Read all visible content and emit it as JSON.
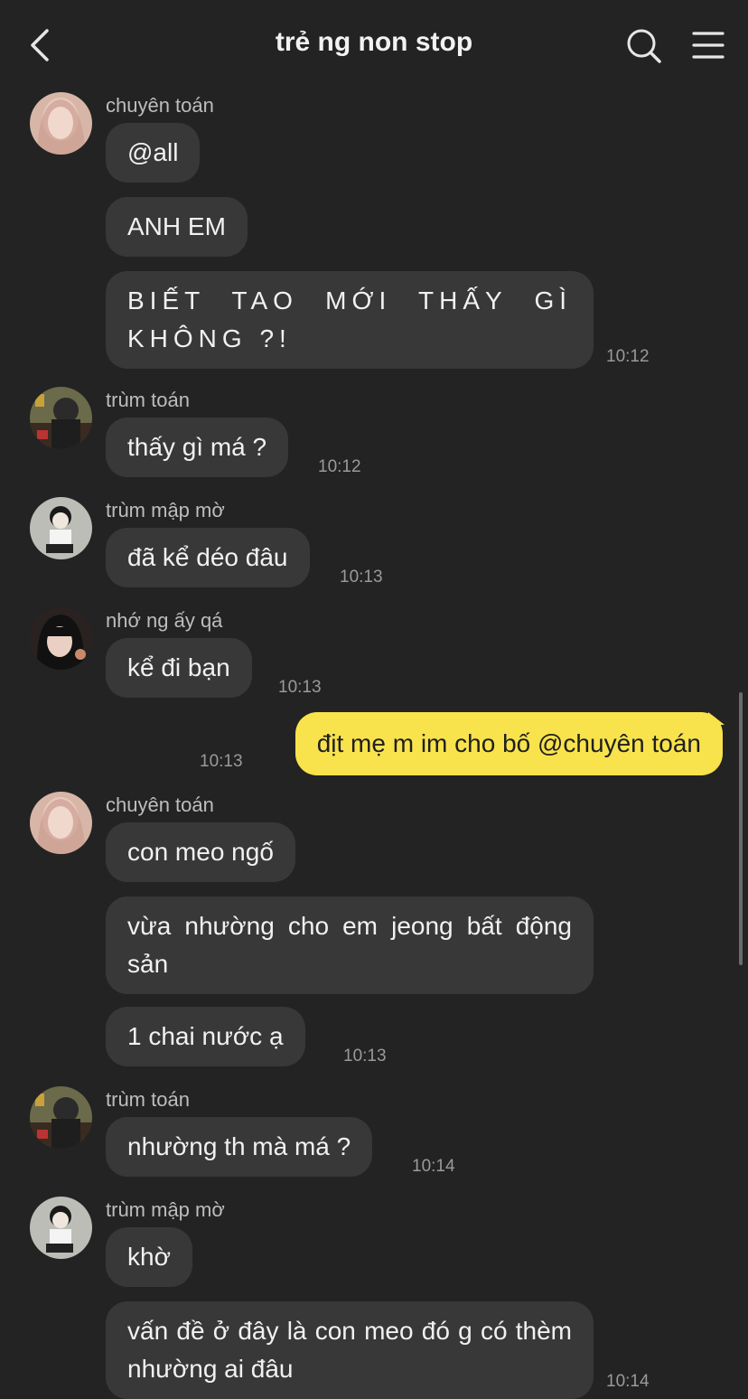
{
  "header": {
    "title": "trẻ ng non stop",
    "back_icon": "chevron-left-icon",
    "search_icon": "search-icon",
    "menu_icon": "menu-icon"
  },
  "colors": {
    "background": "#232323",
    "bubble_incoming": "#383838",
    "bubble_outgoing": "#f9e34c"
  },
  "messages": [
    {
      "sender": "chuyên toán",
      "avatar": "avatar-chuyen-toan",
      "bubbles": [
        "@all",
        "ANH EM",
        "BIẾT TAO MỚI THẤY GÌ KHÔNG ?!"
      ],
      "time": "10:12"
    },
    {
      "sender": "trùm toán",
      "avatar": "avatar-trum-toan",
      "bubbles": [
        "thấy gì má ?"
      ],
      "time": "10:12"
    },
    {
      "sender": "trùm mập mờ",
      "avatar": "avatar-trum-map-mo",
      "bubbles": [
        "đã kể déo đâu"
      ],
      "time": "10:13"
    },
    {
      "sender": "nhớ ng ấy qá",
      "avatar": "avatar-nho-ng-ay-qa",
      "bubbles": [
        "kể đi bạn"
      ],
      "time": "10:13"
    },
    {
      "sender": "me",
      "bubbles": [
        "địt mẹ m im cho bố @chuyên toán"
      ],
      "time": "10:13"
    },
    {
      "sender": "chuyên toán",
      "avatar": "avatar-chuyen-toan",
      "bubbles": [
        "con meo ngố",
        "vừa nhường cho em jeong bất động sản",
        "1 chai nước ạ"
      ],
      "time": "10:13"
    },
    {
      "sender": "trùm toán",
      "avatar": "avatar-trum-toan",
      "bubbles": [
        "nhường th mà má ?"
      ],
      "time": "10:14"
    },
    {
      "sender": "trùm mập mờ",
      "avatar": "avatar-trum-map-mo",
      "bubbles": [
        "khờ",
        "vấn đề ở đây là con meo đó g có thèm nhường ai đâu"
      ],
      "time": "10:14"
    }
  ]
}
